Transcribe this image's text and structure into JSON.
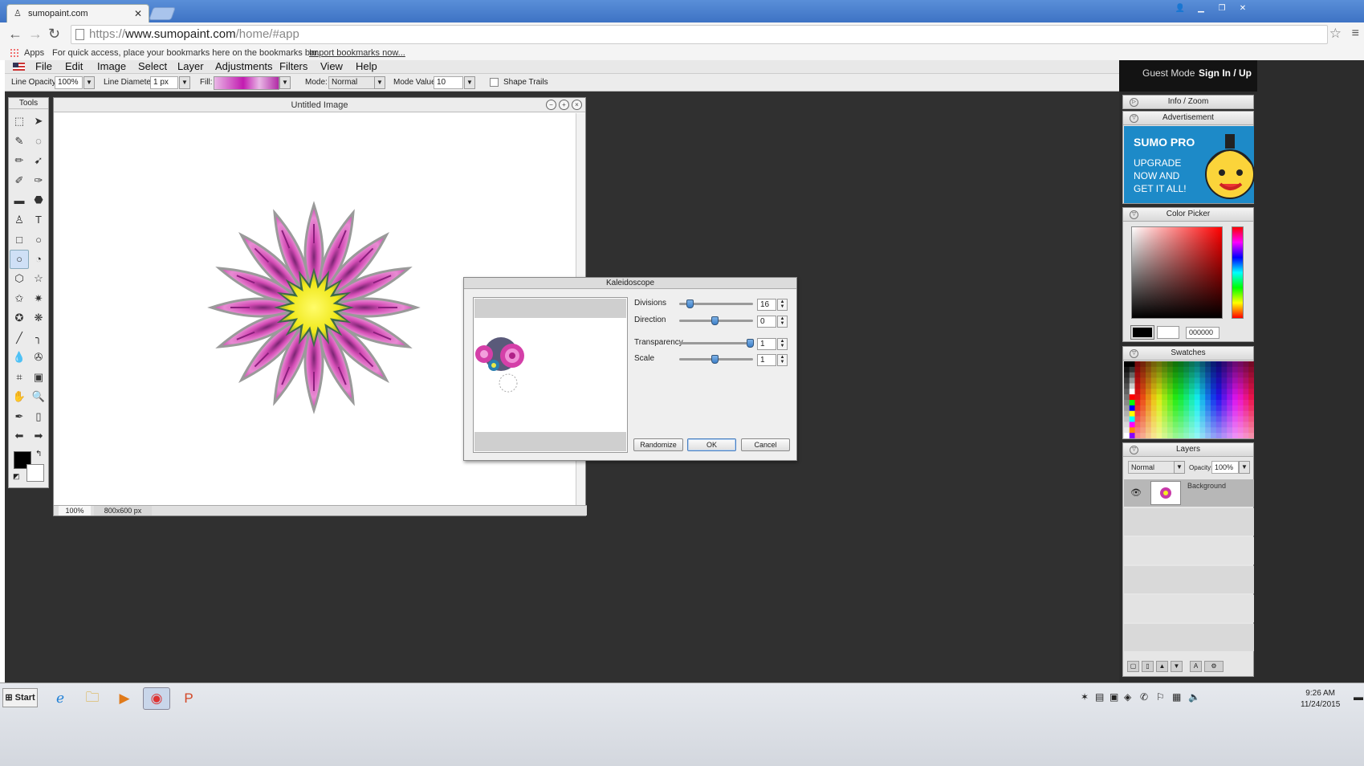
{
  "browser": {
    "tab_title": "sumopaint.com",
    "url_scheme": "https://",
    "url_host": "www.sumopaint.com",
    "url_path": "/home/#app",
    "bookmarks_apps": "Apps",
    "bookmarks_hint": "For quick access, place your bookmarks here on the bookmarks bar.",
    "bookmarks_import": "Import bookmarks now..."
  },
  "menu": [
    "File",
    "Edit",
    "Image",
    "Select",
    "Layer",
    "Adjustments",
    "Filters",
    "View",
    "Help"
  ],
  "options": {
    "line_opacity_label": "Line Opacity:",
    "line_opacity_value": "100%",
    "line_diameter_label": "Line Diameter:",
    "line_diameter_value": "1 px",
    "fill_label": "Fill:",
    "mode_label": "Mode:",
    "mode_value": "Normal",
    "mode_value_label": "Mode Value:",
    "mode_value_value": "10",
    "shape_trails_label": "Shape Trails"
  },
  "tools": {
    "title": "Tools",
    "icons": [
      "selection-rect",
      "move-arrow",
      "magic-wand",
      "lasso",
      "pencil",
      "brush",
      "airbrush",
      "smudge",
      "gradient",
      "bucket",
      "clone-stamp",
      "text",
      "rectangle",
      "ellipse",
      "circle",
      "rounded-shape",
      "polygon",
      "star",
      "star5",
      "star-burst",
      "star-outline",
      "flower-shape",
      "line",
      "curve",
      "drop",
      "blur",
      "crop",
      "transform",
      "hand",
      "zoom",
      "eyedropper",
      "trash",
      "arrow-left",
      "arrow-right"
    ],
    "glyphs": [
      "⬚",
      "➤",
      "✎",
      "◌",
      "✏",
      "➹",
      "✐",
      "✑",
      "▬",
      "⬣",
      "♙",
      "T",
      "□",
      "○",
      "○",
      "◔",
      "⬡",
      "☆",
      "✩",
      "✷",
      "✪",
      "❋",
      "╱",
      "╮",
      "💧",
      "✇",
      "⌗",
      "▣",
      "✋",
      "🔍",
      "✒",
      "▯",
      "⬅",
      "➡"
    ],
    "active_index": 14
  },
  "image_window": {
    "title": "Untitled Image",
    "zoom": "100%",
    "dimensions": "800x600 px"
  },
  "kaleidoscope": {
    "title": "Kaleidoscope",
    "params": [
      {
        "label": "Divisions",
        "value": "16",
        "fraction": 0.15
      },
      {
        "label": "Direction",
        "value": "0",
        "fraction": 0.5
      },
      {
        "label": "Transparency",
        "value": "1",
        "fraction": 1.0
      },
      {
        "label": "Scale",
        "value": "1",
        "fraction": 0.5
      }
    ],
    "buttons": {
      "randomize": "Randomize",
      "ok": "OK",
      "cancel": "Cancel"
    }
  },
  "account": {
    "guest": "Guest Mode",
    "signin": "Sign In / Up"
  },
  "panels": {
    "info": "Info / Zoom",
    "advertisement": "Advertisement",
    "ad_title": "SUMO PRO",
    "ad_body": "UPGRADE NOW AND GET IT ALL!",
    "color_picker": "Color Picker",
    "hex": "000000",
    "swatches": "Swatches",
    "layers": "Layers",
    "layer_mode": "Normal",
    "opacity_label": "Opacity:",
    "opacity_value": "100%",
    "layer_name": "Background"
  },
  "taskbar": {
    "start": "Start",
    "time": "9:26 AM",
    "date": "11/24/2015"
  },
  "colors": {
    "petal": "#c83aa8",
    "center": "#f4f01e",
    "accent": "#4a7fc0"
  }
}
